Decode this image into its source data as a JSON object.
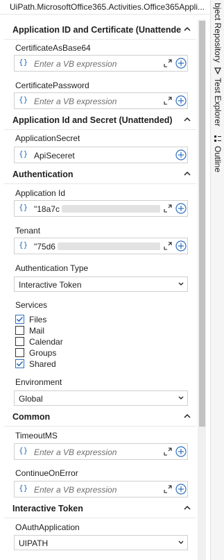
{
  "window": {
    "title": "UiPath.MicrosoftOffice365.Activities.Office365Appli..."
  },
  "side_tabs": [
    "bject Repository",
    "Test Explorer",
    "Outline"
  ],
  "sections": {
    "appid_cert": "Application ID and Certificate (Unattende",
    "appid_secret": "Application Id and Secret (Unattended)",
    "authentication": "Authentication",
    "common": "Common",
    "interactive_token": "Interactive Token"
  },
  "props": {
    "cert_b64": {
      "label": "CertificateAsBase64",
      "placeholder": "Enter a VB expression"
    },
    "cert_pwd": {
      "label": "CertificatePassword",
      "placeholder": "Enter a VB expression"
    },
    "app_secret": {
      "label": "ApplicationSecret",
      "value": "ApiSeceret"
    },
    "app_id": {
      "label": "Application Id",
      "value": "\"18a7c"
    },
    "tenant": {
      "label": "Tenant",
      "value": "\"75d6"
    },
    "auth_type": {
      "label": "Authentication Type",
      "value": "Interactive Token"
    },
    "services": {
      "label": "Services",
      "items": [
        {
          "label": "Files",
          "checked": true
        },
        {
          "label": "Mail",
          "checked": false
        },
        {
          "label": "Calendar",
          "checked": false
        },
        {
          "label": "Groups",
          "checked": false
        },
        {
          "label": "Shared",
          "checked": true
        }
      ]
    },
    "environment": {
      "label": "Environment",
      "value": "Global"
    },
    "timeout": {
      "label": "TimeoutMS",
      "placeholder": "Enter a VB expression"
    },
    "continue_on_error": {
      "label": "ContinueOnError",
      "placeholder": "Enter a VB expression"
    },
    "oauth_app": {
      "label": "OAuthApplication",
      "value": "UIPATH"
    }
  },
  "colors": {
    "accent": "#2d6fc0",
    "section_text": "#1e1e1e",
    "placeholder": "#6e6e6e"
  }
}
